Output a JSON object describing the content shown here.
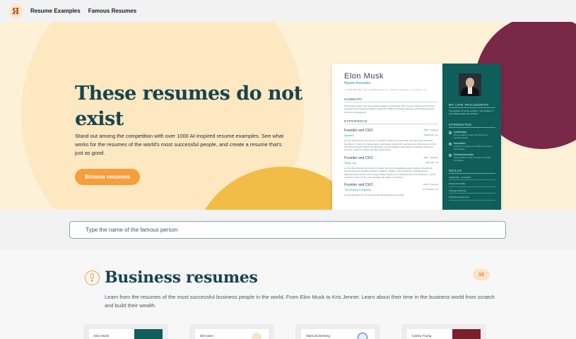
{
  "nav": {
    "logo_glyph": "Я",
    "links": [
      "Resume Examples",
      "Famous Resumes"
    ]
  },
  "hero": {
    "title": "These resumes do not exist",
    "description": "Stand out among the competition with over 1000 AI-inspired resume examples. See what works for the resumes of the world's most successful people, and create a resume that's just as good.",
    "cta_label": "Browse resumes",
    "colors": {
      "background": "#fdf1d8",
      "accent": "#f59e3b",
      "maroon": "#7a2847",
      "yellow": "#f2bd47",
      "title": "#17444f"
    }
  },
  "resume_preview": {
    "name": "Elon Musk",
    "role": "Master Innovator",
    "contact": "+1 (555) 555-5555 · elon.musk@example.com · linkedin.com/in/elon · Los Angeles, CA",
    "summary_heading": "SUMMARY",
    "summary_text": "Passionate entrepreneur and visionary leader in technology, with a proven track record of driving innovation and creating disruptive companies. Skilled in strategic planning, product development, and team management.",
    "experience_heading": "EXPERIENCE",
    "jobs": [
      {
        "title": "Founder and CEO",
        "date": "2002 - Ongoing",
        "company": "SpaceX",
        "location": "Hawthorne, CA",
        "text": "Led the development and launch of reusable rockets and spacecraft. Developed and launched the Falcon 1, Falcon 9, Falcon Heavy, and Dragon spacecraft. Launched over 100 missions to the International Space Station and deployed over 60 satellites. Developed the Starship spacecraft for future missions to Mars and other destinations."
      },
      {
        "title": "Founder and CEO",
        "date": "2003 - Ongoing",
        "company": "Tesla, Inc.",
        "location": "Palo Alto, CA",
        "text": "Led the development and launch of electric cars and sustainable energy solutions. Developed and launched the Roadster, Model S, Model X, Model 3, and Cybertruck. Developed and deployed solar products and energy storage solutions for residential and commercial use. Led the company to become the most valuable automaker in the world."
      },
      {
        "title": "Founder and CEO",
        "date": "2016 - Ongoing",
        "company": "The Boring Company",
        "location": "Los Angeles, CA",
        "text": "Led the development of tunneling and transportation technology."
      }
    ],
    "sidebar": {
      "philosophy_heading": "MY LIFE PHILOSOPHY",
      "philosophy_text": "The problem is not the problem. The problem is your attitude about the problem.",
      "strengths_heading": "STRENGTHS",
      "strengths": [
        {
          "title": "Leadership",
          "desc": "Proven ability to inspire and lead cross-functional teams."
        },
        {
          "title": "Innovation",
          "desc": "A history of creating and implementing new technologies."
        },
        {
          "title": "Entrepreneurship",
          "desc": "Proven ability to start and grow successful companies."
        }
      ],
      "skills_heading": "SKILLS",
      "skills": [
        "Leadership · Innovation",
        "Entrepreneurship",
        "Strategic Planning",
        "Product Development"
      ]
    }
  },
  "search": {
    "placeholder": "Type the name of the famous person"
  },
  "business": {
    "icon": "microphone-icon",
    "title": "Business resumes",
    "count": "15",
    "description": "Learn from the resumes of the most successful business people in the world. From Elon Musk to Kris Jenner. Learn about their time in the business world from scratch and build their wealth.",
    "cards": [
      {
        "name": "Elon Musk",
        "side_color": "#0f5e5c"
      },
      {
        "name": "Bill Gates",
        "side_color": ""
      },
      {
        "name": "Mark Zuckerberg",
        "side_color": ""
      },
      {
        "name": "Ivanka Trump",
        "side_color": "#7a1f2b"
      }
    ]
  }
}
